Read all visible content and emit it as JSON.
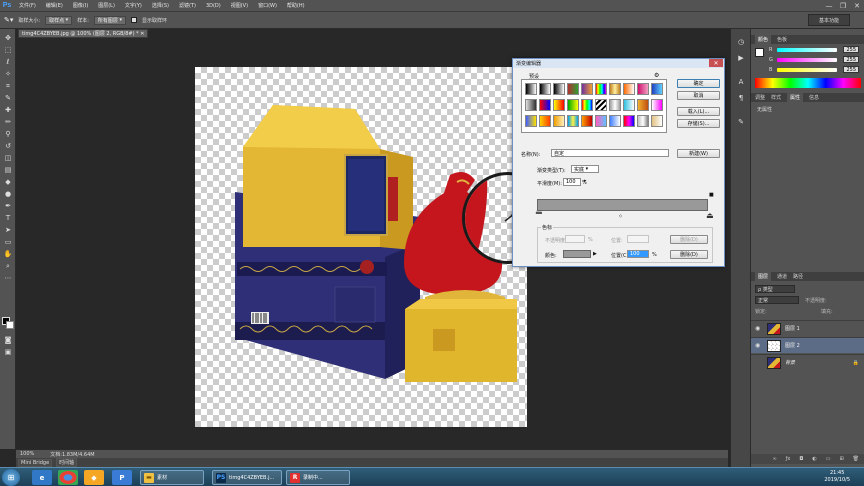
{
  "app": {
    "logo": "Ps"
  },
  "menu": [
    "文件(F)",
    "编辑(E)",
    "图像(I)",
    "图层(L)",
    "文字(Y)",
    "选择(S)",
    "滤镜(T)",
    "3D(D)",
    "视图(V)",
    "窗口(W)",
    "帮助(H)"
  ],
  "window_controls": {
    "minimize": "—",
    "restore": "❐",
    "close": "✕"
  },
  "options": {
    "sample_size_label": "取样大小:",
    "sample_size_value": "取样点",
    "sample_label": "样本:",
    "sample_value": "所有图层",
    "show_ring_label": "显示取样环",
    "workspace": "基本功能"
  },
  "document_tab": "timg4C4ZBYEB.jpg @ 100% (图层 2, RGB/8#) * ✕",
  "status": {
    "zoom": "100%",
    "doc": "文档:1.83M/4.64M"
  },
  "minibridge": [
    "Mini Bridge",
    "时间轴"
  ],
  "color_panel": {
    "tabs": [
      "颜色",
      "色板"
    ],
    "channels": [
      {
        "label": "R",
        "value": "255"
      },
      {
        "label": "G",
        "value": "255"
      },
      {
        "label": "B",
        "value": "255"
      }
    ]
  },
  "props_panel": {
    "tabs": [
      "调整",
      "样式",
      "属性",
      "信息"
    ],
    "empty_text": "无属性"
  },
  "layers_panel": {
    "tabs": [
      "图层",
      "通道",
      "路径"
    ],
    "kind_label": "ρ 类型",
    "blend_mode": "正常",
    "opacity_label": "不透明度:",
    "lock_label": "锁定:",
    "fill_label": "填充:",
    "layers": [
      {
        "name": "图层 1",
        "selected": false
      },
      {
        "name": "图层 2",
        "selected": true
      },
      {
        "name": "背景",
        "selected": false
      }
    ]
  },
  "dialog": {
    "title": "渐变编辑器",
    "close": "✕",
    "presets_label": "预设",
    "buttons": {
      "ok": "确定",
      "cancel": "取消",
      "load": "载入(L)...",
      "save": "存储(S)...",
      "new": "新建(W)"
    },
    "name_label": "名称(N):",
    "name_value": "自定",
    "type_label": "渐变类型(T):",
    "type_value": "实底",
    "smooth_label": "平滑度(M):",
    "smooth_value": "100",
    "smooth_unit": "%",
    "stops_label": "色标",
    "opacity_label": "不透明度:",
    "opacity_unit": "%",
    "position_label": "位置:",
    "delete1": "删除(D)",
    "color_label": "颜色:",
    "position2_label": "位置(C):",
    "position2_value": "100",
    "position2_unit": "%",
    "delete2": "删除(D)"
  },
  "taskbar": {
    "tasks": [
      {
        "icon": "PS",
        "label": "timg4C4ZBYEB.j..."
      },
      {
        "icon": "R",
        "label": "录制中..."
      }
    ],
    "folder_label": "素材",
    "time": "21:45",
    "date": "2019/10/5"
  }
}
